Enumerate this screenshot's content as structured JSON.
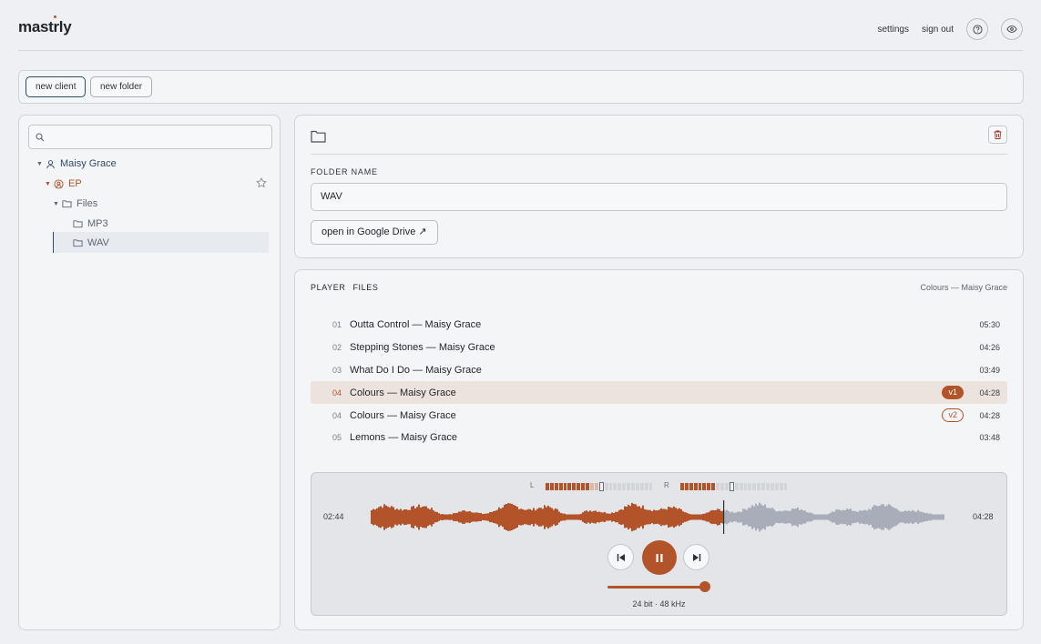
{
  "app": {
    "logo": "mastrly"
  },
  "header": {
    "settings_label": "settings",
    "signout_label": "sign out",
    "help_icon": "help-circle-icon",
    "preview_icon": "eye-icon"
  },
  "toolbar": {
    "new_client_label": "new client",
    "new_folder_label": "new folder"
  },
  "sidebar": {
    "search_placeholder": "",
    "tree": {
      "client": "Maisy Grace",
      "project": "EP",
      "folder": "Files",
      "subfolders": [
        "MP3",
        "WAV"
      ],
      "selected": "WAV"
    }
  },
  "folder_panel": {
    "label": "FOLDER NAME",
    "name_value": "WAV",
    "drive_button_label": "open in Google Drive ↗"
  },
  "player": {
    "tabs": [
      "PLAYER",
      "FILES"
    ],
    "now_playing": "Colours — Maisy Grace",
    "tracks": [
      {
        "num": "01",
        "title": "Outta Control — Maisy Grace",
        "version": "",
        "duration": "05:30"
      },
      {
        "num": "02",
        "title": "Stepping Stones — Maisy Grace",
        "version": "",
        "duration": "04:26"
      },
      {
        "num": "03",
        "title": "What Do I Do — Maisy Grace",
        "version": "",
        "duration": "03:49"
      },
      {
        "num": "04",
        "title": "Colours — Maisy Grace",
        "version": "v1",
        "duration": "04:28"
      },
      {
        "num": "04",
        "title": "Colours — Maisy Grace",
        "version": "v2",
        "duration": "04:28"
      },
      {
        "num": "05",
        "title": "Lemons — Maisy Grace",
        "version": "",
        "duration": "03:48"
      }
    ],
    "active_track_index": 3,
    "meter_left_label": "L",
    "meter_right_label": "R",
    "current_time": "02:44",
    "total_time": "04:28",
    "progress_fraction": 0.61,
    "volume_fraction": 0.93,
    "format": "24 bit · 48 kHz",
    "colors": {
      "accent": "#b2532a",
      "unplayed": "#a9adb9"
    }
  }
}
